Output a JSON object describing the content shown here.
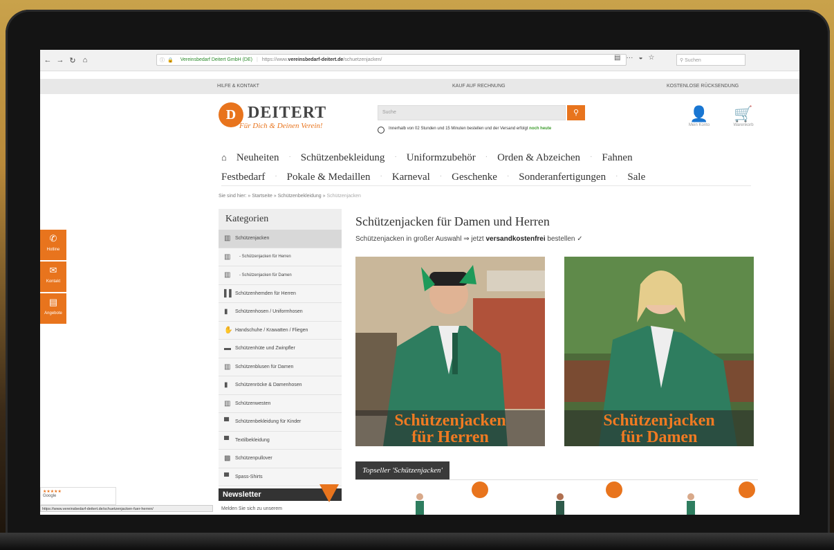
{
  "browser": {
    "site_label": "Vereinsbedarf Deitert GmbH (DE)",
    "url_prefix": "https://www.",
    "url_domain": "vereinsbedarf-deitert.de",
    "url_path": "/schuetzenjacken/",
    "search_placeholder": "Suchen"
  },
  "service_bar": {
    "left": "HILFE & KONTAKT",
    "center": "KAUF AUF RECHNUNG",
    "right": "KOSTENLOSE RÜCKSENDUNG"
  },
  "header": {
    "logo_letter": "D",
    "logo_text": "DEITERT",
    "logo_slogan": "Für Dich & Deinen Verein!",
    "search_placeholder": "Suche",
    "delivery_text": "Innerhalb von 02 Stunden und 15 Minuten bestellen und der Versand erfolgt",
    "delivery_highlight": "noch heute",
    "account_label": "Mein Konto",
    "cart_label": "Warenkorb"
  },
  "nav": {
    "row1": [
      "Neuheiten",
      "Schützenbekleidung",
      "Uniformzubehör",
      "Orden & Abzeichen",
      "Fahnen"
    ],
    "row2": [
      "Festbedarf",
      "Pokale & Medaillen",
      "Karneval",
      "Geschenke",
      "Sonderanfertigungen",
      "Sale"
    ]
  },
  "breadcrumb": {
    "prefix": "Sie sind hier:",
    "items": [
      "Startseite",
      "Schützenbekleidung",
      "Schützenjacken"
    ]
  },
  "sidebar": {
    "title": "Kategorien",
    "items": [
      {
        "label": "Schützenjacken",
        "icon": "jacket-icon",
        "glyph": "▥"
      },
      {
        "label": "- Schützenjacken für Herren",
        "icon": "jacket-icon",
        "glyph": "▥"
      },
      {
        "label": "- Schützenjacken für Damen",
        "icon": "jacket-icon",
        "glyph": "▥"
      },
      {
        "label": "Schützenhemden für Herren",
        "icon": "shirt-icon",
        "glyph": "▌▌"
      },
      {
        "label": "Schützenhosen / Uniformhosen",
        "icon": "trousers-icon",
        "glyph": "▮"
      },
      {
        "label": "Handschuhe / Krawatten / Fliegen",
        "icon": "glove-icon",
        "glyph": "✋"
      },
      {
        "label": "Schützenhüte und Zwinpfler",
        "icon": "hat-icon",
        "glyph": "▬"
      },
      {
        "label": "Schützenblusen für Damen",
        "icon": "blouse-icon",
        "glyph": "▥"
      },
      {
        "label": "Schützenröcke & Damenhosen",
        "icon": "skirt-icon",
        "glyph": "▮"
      },
      {
        "label": "Schützenwesten",
        "icon": "vest-icon",
        "glyph": "▥"
      },
      {
        "label": "Schützenbekleidung für Kinder",
        "icon": "kids-shirt-icon",
        "glyph": "▀"
      },
      {
        "label": "Textilbekleidung",
        "icon": "tshirt-icon",
        "glyph": "▀"
      },
      {
        "label": "Schützenpullover",
        "icon": "pullover-icon",
        "glyph": "▩"
      },
      {
        "label": "Spass-Shirts",
        "icon": "tshirt-icon",
        "glyph": "▀"
      }
    ]
  },
  "newsletter": {
    "title": "Newsletter",
    "sub": "Melden Sie sich zu unserem"
  },
  "left_tabs": [
    {
      "label": "Hotline",
      "icon": "phone-icon",
      "glyph": "✆"
    },
    {
      "label": "Kontakt",
      "icon": "mail-icon",
      "glyph": "✉"
    },
    {
      "label": "Angebote",
      "icon": "offer-icon",
      "glyph": "▤"
    }
  ],
  "rating": {
    "stars": "★★★★★",
    "label": "Google"
  },
  "status_url": "https://www.vereinsbedarf-deitert.de/schuetzenjacken-fuer-herren/",
  "content": {
    "title": "Schützenjacken für Damen und Herren",
    "lead_pre": "Schützenjacken in großer Auswahl ⇒ jetzt ",
    "lead_bold": "versandkostenfrei",
    "lead_post": " bestellen ✓",
    "tile_herren_line1": "Schützenjacken",
    "tile_herren_line2": "für Herren",
    "tile_damen_line1": "Schützenjacken",
    "tile_damen_line2": "für Damen",
    "topseller": "Topseller 'Schützenjacken'"
  },
  "colors": {
    "accent": "#e8741d",
    "jacket_green": "#2e7d5f"
  }
}
